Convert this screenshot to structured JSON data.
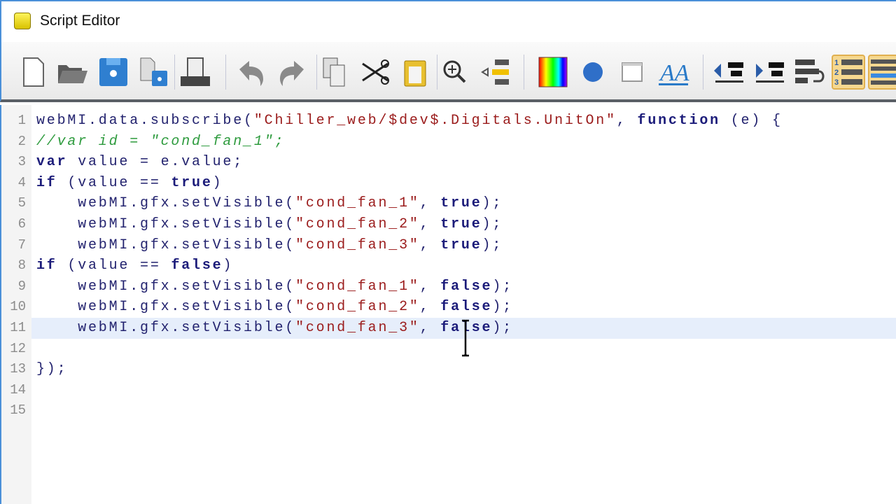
{
  "window": {
    "title": "Script Editor",
    "app_icon": "!!"
  },
  "toolbar": {
    "buttons": [
      "new-file",
      "open-folder",
      "save",
      "save-as",
      "print",
      "undo",
      "redo",
      "copy",
      "cut",
      "paste",
      "find",
      "insert-item",
      "color-palette",
      "circle",
      "window",
      "font",
      "outdent",
      "indent",
      "word-wrap",
      "line-numbers",
      "layout"
    ]
  },
  "colors": {
    "keyword": "#1c1c7a",
    "string": "#9b1c1c",
    "comment": "#2e9b3e",
    "current_line": "#e6eefb"
  },
  "editor": {
    "current_line": 11,
    "lines": [
      {
        "num": "1",
        "tokens": [
          {
            "t": "webMI.data.subscribe(",
            "c": "pl"
          },
          {
            "t": "\"Chiller_web/$dev$.Digitals.UnitOn\"",
            "c": "str"
          },
          {
            "t": ", ",
            "c": "pl"
          },
          {
            "t": "function",
            "c": "kw"
          },
          {
            "t": " (e) {",
            "c": "pl"
          }
        ]
      },
      {
        "num": "2",
        "tokens": [
          {
            "t": "//var id = \"cond_fan_1\";",
            "c": "cm"
          }
        ]
      },
      {
        "num": "3",
        "tokens": [
          {
            "t": "var",
            "c": "kw"
          },
          {
            "t": " value = e.value;",
            "c": "pl"
          }
        ]
      },
      {
        "num": "4",
        "tokens": [
          {
            "t": "if",
            "c": "kw"
          },
          {
            "t": " (value == ",
            "c": "pl"
          },
          {
            "t": "true",
            "c": "kw"
          },
          {
            "t": ")",
            "c": "pl"
          }
        ]
      },
      {
        "num": "5",
        "tokens": [
          {
            "t": "    webMI.gfx.setVisible(",
            "c": "pl"
          },
          {
            "t": "\"cond_fan_1\"",
            "c": "str"
          },
          {
            "t": ", ",
            "c": "pl"
          },
          {
            "t": "true",
            "c": "kw"
          },
          {
            "t": ");",
            "c": "pl"
          }
        ]
      },
      {
        "num": "6",
        "tokens": [
          {
            "t": "    webMI.gfx.setVisible(",
            "c": "pl"
          },
          {
            "t": "\"cond_fan_2\"",
            "c": "str"
          },
          {
            "t": ", ",
            "c": "pl"
          },
          {
            "t": "true",
            "c": "kw"
          },
          {
            "t": ");",
            "c": "pl"
          }
        ]
      },
      {
        "num": "7",
        "tokens": [
          {
            "t": "    webMI.gfx.setVisible(",
            "c": "pl"
          },
          {
            "t": "\"cond_fan_3\"",
            "c": "str"
          },
          {
            "t": ", ",
            "c": "pl"
          },
          {
            "t": "true",
            "c": "kw"
          },
          {
            "t": ");",
            "c": "pl"
          }
        ]
      },
      {
        "num": "8",
        "tokens": [
          {
            "t": "if",
            "c": "kw"
          },
          {
            "t": " (value == ",
            "c": "pl"
          },
          {
            "t": "false",
            "c": "kw"
          },
          {
            "t": ")",
            "c": "pl"
          }
        ]
      },
      {
        "num": "9",
        "tokens": [
          {
            "t": "    webMI.gfx.setVisible(",
            "c": "pl"
          },
          {
            "t": "\"cond_fan_1\"",
            "c": "str"
          },
          {
            "t": ", ",
            "c": "pl"
          },
          {
            "t": "false",
            "c": "kw"
          },
          {
            "t": ");",
            "c": "pl"
          }
        ]
      },
      {
        "num": "10",
        "tokens": [
          {
            "t": "    webMI.gfx.setVisible(",
            "c": "pl"
          },
          {
            "t": "\"cond_fan_2\"",
            "c": "str"
          },
          {
            "t": ", ",
            "c": "pl"
          },
          {
            "t": "false",
            "c": "kw"
          },
          {
            "t": ");",
            "c": "pl"
          }
        ]
      },
      {
        "num": "11",
        "tokens": [
          {
            "t": "    webMI.gfx.setVisible(",
            "c": "pl"
          },
          {
            "t": "\"cond_fan_3\"",
            "c": "str"
          },
          {
            "t": ", ",
            "c": "pl"
          },
          {
            "t": "false",
            "c": "kw"
          },
          {
            "t": ");",
            "c": "pl"
          }
        ]
      },
      {
        "num": "12",
        "tokens": []
      },
      {
        "num": "13",
        "tokens": [
          {
            "t": "});",
            "c": "pl"
          }
        ]
      },
      {
        "num": "14",
        "tokens": []
      },
      {
        "num": "15",
        "tokens": []
      }
    ]
  }
}
